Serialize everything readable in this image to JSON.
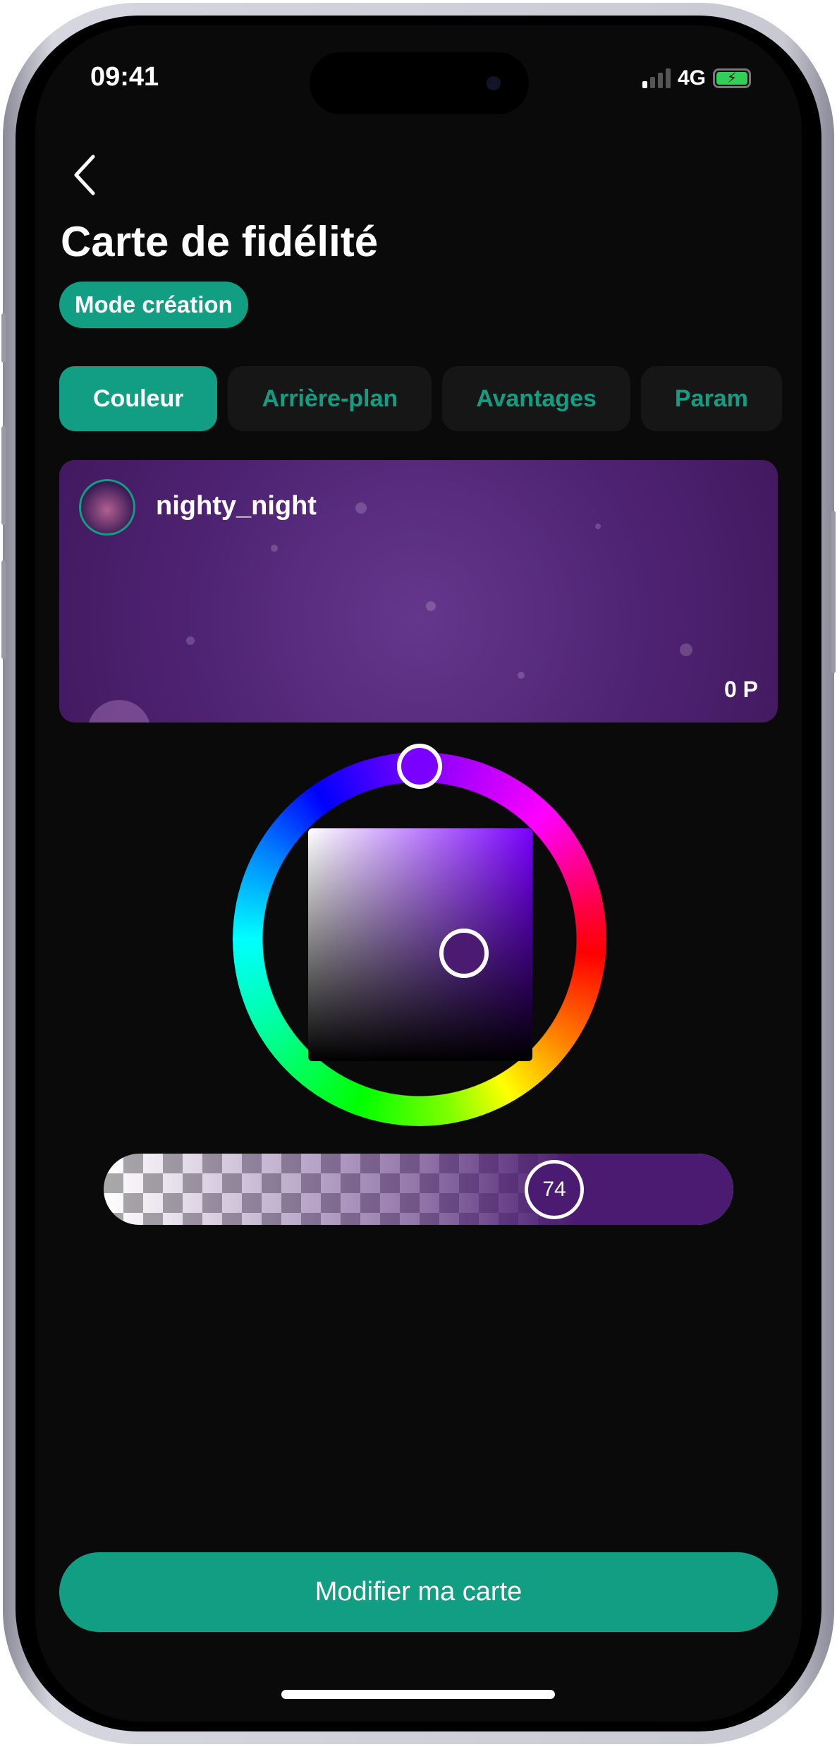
{
  "status_bar": {
    "time": "09:41",
    "network": "4G",
    "battery_icon": "battery-charging-icon",
    "signal_icon": "signal-icon"
  },
  "header": {
    "back_icon": "chevron-left-icon",
    "title": "Carte de fidélité",
    "badge": "Mode création"
  },
  "tabs": [
    {
      "label": "Couleur",
      "active": true
    },
    {
      "label": "Arrière-plan",
      "active": false
    },
    {
      "label": "Avantages",
      "active": false
    },
    {
      "label": "Param",
      "active": false
    }
  ],
  "card": {
    "username": "nighty_night",
    "points": "0 P",
    "color": "#4e2272"
  },
  "color_picker": {
    "hue_color": "#7a00ff",
    "selected_color": "#4a1b70",
    "opacity_value": "74"
  },
  "footer": {
    "submit_label": "Modifier ma carte"
  },
  "colors": {
    "accent": "#119e83",
    "background": "#0a0a0a",
    "tab_bg": "#161616"
  }
}
